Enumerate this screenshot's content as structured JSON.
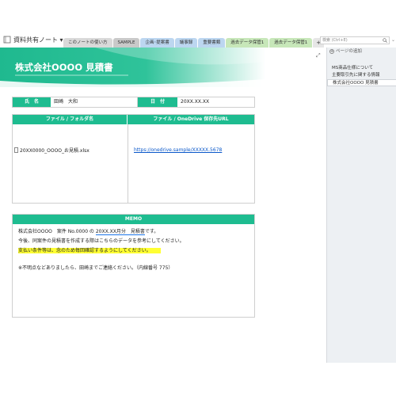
{
  "notebook": {
    "title": "資料共有ノート ▾"
  },
  "tabs": [
    {
      "label": "このノートの使い方",
      "color": "#d9d9d9"
    },
    {
      "label": "SAMPLE",
      "color": "#c9c9c9"
    },
    {
      "label": "企画･提案書",
      "color": "#bcd6f0"
    },
    {
      "label": "議事録",
      "color": "#bcd6f0"
    },
    {
      "label": "重要書類",
      "color": "#bcd6f0"
    },
    {
      "label": "過去データ保管1",
      "color": "#c7e7b9"
    },
    {
      "label": "過去データ保管1",
      "color": "#c7e7b9"
    },
    {
      "label": "+",
      "color": "#e6e6e6"
    }
  ],
  "search": {
    "placeholder": "検索 (Ctrl+E)"
  },
  "page": {
    "title": "株式会社OOOO 見積書",
    "info": {
      "name_label": "氏　名",
      "name_value": "田崎　大和",
      "date_label": "日　付",
      "date_value": "20XX.XX.XX"
    },
    "files": {
      "header_left": "ファイル / フォルダ名",
      "header_right": "ファイル / OneDrive 保存先URL",
      "file_name": "20XX0000_OOOO_お見積.xlsx",
      "url": "https://onedrive.sample/XXXXX.5678"
    },
    "memo": {
      "header": "MEMO",
      "line1_a": "株式会社OOOO　案件 No.0000 の ",
      "line1_b": "20XX.XX月分　見積書",
      "line1_c": "です。",
      "line2": "今後、同案件の見積書を作成する際はこちらのデータを参考にしてください。",
      "line3": "支払い条件等は、念のため毎回確認するようにしてください。",
      "line4": "※不明点などありましたら、田崎までご連絡ください。（内線番号 775）"
    }
  },
  "sidebar": {
    "add_page_label": "ページの追加",
    "pages": [
      {
        "label": "MS商品仕様について",
        "active": false
      },
      {
        "label": "主要取引先に関する情報",
        "active": false
      },
      {
        "label": "株式会社OOOO 見積書",
        "active": true
      }
    ]
  },
  "colors": {
    "accent": "#1ebc90",
    "highlight": "#ffff33",
    "link": "#0a58ca"
  }
}
